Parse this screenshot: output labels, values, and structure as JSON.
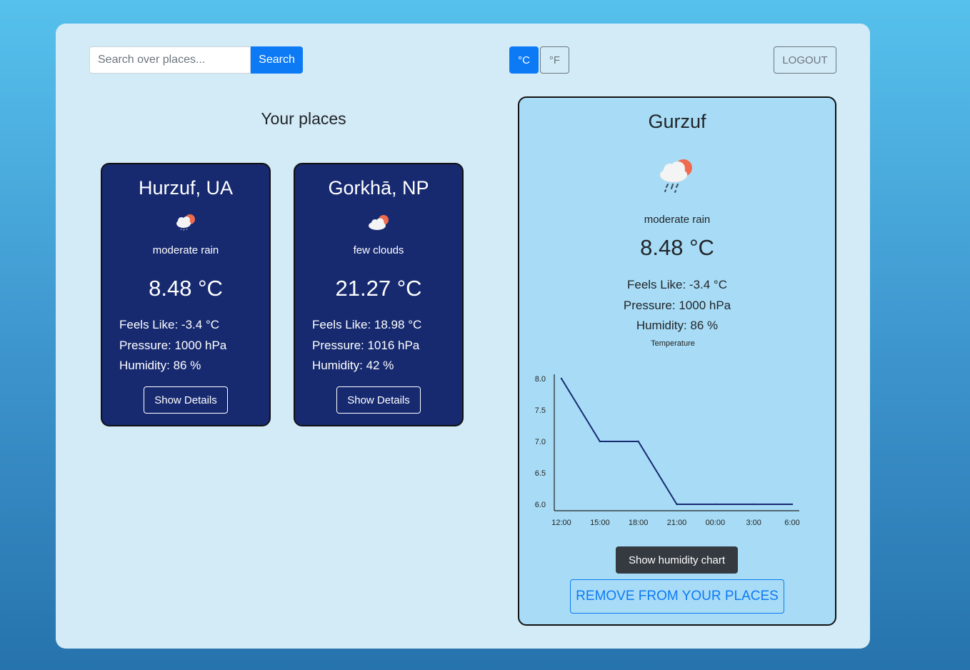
{
  "search": {
    "placeholder": "Search over places...",
    "button_label": "Search"
  },
  "units": {
    "celsius_label": "°C",
    "fahrenheit_label": "°F",
    "selected": "°C"
  },
  "logout_label": "LOGOUT",
  "places_title": "Your places",
  "place_cards": [
    {
      "name": "Hurzuf, UA",
      "icon": "rain-cloud-sun-icon",
      "description": "moderate rain",
      "temperature": "8.48 °C",
      "feels_like": "Feels Like: -3.4 °C",
      "pressure": "Pressure: 1000 hPa",
      "humidity": "Humidity: 86 %",
      "button_label": "Show Details"
    },
    {
      "name": "Gorkhā, NP",
      "icon": "cloud-sun-icon",
      "description": "few clouds",
      "temperature": "21.27 °C",
      "feels_like": "Feels Like: 18.98 °C",
      "pressure": "Pressure: 1016 hPa",
      "humidity": "Humidity: 42 %",
      "button_label": "Show Details"
    }
  ],
  "detail": {
    "name": "Gurzuf",
    "icon": "rain-cloud-sun-icon",
    "description": "moderate rain",
    "temperature": "8.48 °C",
    "feels_like": "Feels Like: -3.4 °C",
    "pressure": "Pressure: 1000 hPa",
    "humidity": "Humidity: 86 %",
    "humidity_button_label": "Show humidity chart",
    "remove_button_label": "REMOVE FROM YOUR PLACES"
  },
  "chart_data": {
    "type": "line",
    "title": "Temperature",
    "categories": [
      "12:00",
      "15:00",
      "18:00",
      "21:00",
      "00:00",
      "3:00",
      "6:00"
    ],
    "series": [
      {
        "values": [
          8.0,
          7.0,
          7.0,
          6.0,
          6.0,
          6.0,
          6.0
        ]
      }
    ],
    "yticks": [
      "6.0",
      "6.5",
      "7.0",
      "7.5",
      "8.0"
    ],
    "ylim": [
      6.0,
      8.0
    ],
    "grid": false,
    "line_color": "#172a70"
  }
}
